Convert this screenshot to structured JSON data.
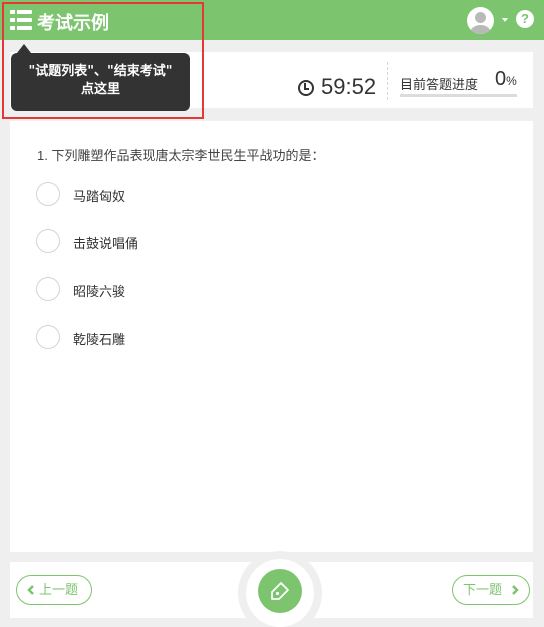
{
  "header": {
    "title": "考试示例"
  },
  "status": {
    "timer": "59:52",
    "progress_label": "目前答题进度",
    "progress_value": "0",
    "progress_unit": "%",
    "progress_fraction": 0
  },
  "tooltip": {
    "line1": "\"试题列表\"、\"结束考试\"",
    "line2": "点这里"
  },
  "question": {
    "text": "1. 下列雕塑作品表现唐太宗李世民生平战功的是：",
    "options": [
      "马踏匈奴",
      "击鼓说唱俑",
      "昭陵六骏",
      "乾陵石雕"
    ]
  },
  "footer": {
    "prev_label": "上一题",
    "next_label": "下一题"
  },
  "colors": {
    "accent": "#7cc46e",
    "highlight": "#e53935",
    "tooltip_bg": "#333333"
  },
  "icons": [
    "menu-list-icon",
    "user-avatar-icon",
    "help-icon",
    "clock-icon",
    "submit-pen-icon"
  ]
}
